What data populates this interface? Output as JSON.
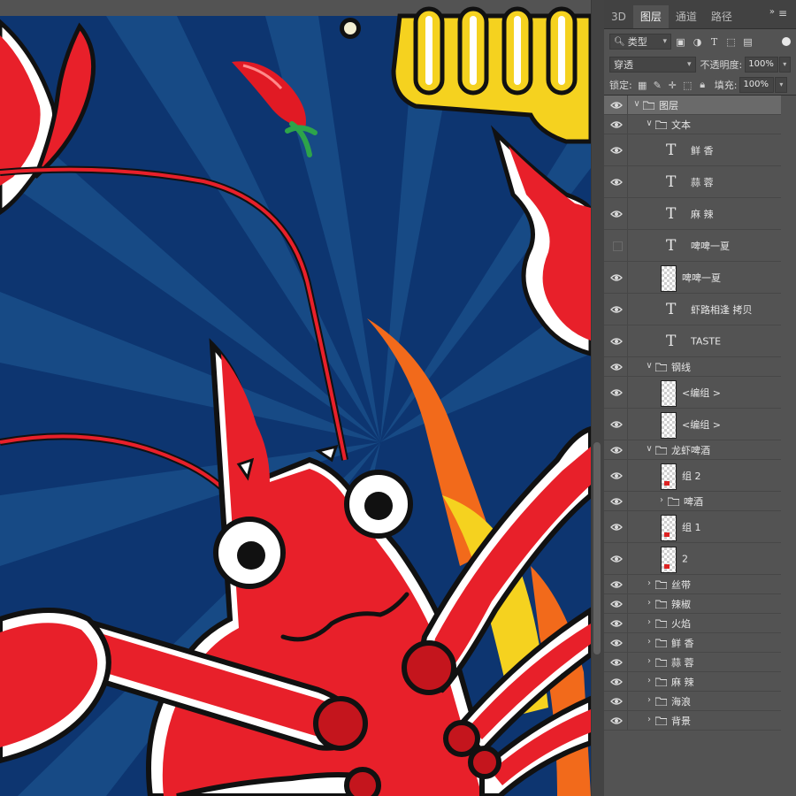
{
  "panel": {
    "tabs": [
      "3D",
      "图层",
      "通道",
      "路径"
    ],
    "active_tab": "图层",
    "filter": {
      "kind_label": "类型"
    },
    "blend_mode": "穿透",
    "opacity_label": "不透明度:",
    "opacity_value": "100%",
    "lock_label": "锁定:",
    "fill_label": "填充:",
    "fill_value": "100%"
  },
  "layers": [
    {
      "name": "图层",
      "type": "group",
      "indent": 0,
      "visible": true,
      "expanded": true,
      "selected": true
    },
    {
      "name": "文本",
      "type": "group",
      "indent": 1,
      "visible": true,
      "expanded": true
    },
    {
      "name": "鲜 香",
      "type": "text",
      "indent": 2,
      "visible": true
    },
    {
      "name": "蒜 蓉",
      "type": "text",
      "indent": 2,
      "visible": true
    },
    {
      "name": "麻 辣",
      "type": "text",
      "indent": 2,
      "visible": true
    },
    {
      "name": "啤啤一夏",
      "type": "text",
      "indent": 2,
      "visible": false
    },
    {
      "name": "啤啤一夏",
      "type": "pixel",
      "indent": 2,
      "visible": true
    },
    {
      "name": "虾路相逢 拷贝",
      "type": "text",
      "indent": 2,
      "visible": true
    },
    {
      "name": "TASTE",
      "type": "text",
      "indent": 2,
      "visible": true
    },
    {
      "name": "钢线",
      "type": "group",
      "indent": 1,
      "visible": true,
      "expanded": true
    },
    {
      "name": "<编组 >",
      "type": "pixel",
      "indent": 2,
      "visible": true
    },
    {
      "name": "<编组 >",
      "type": "pixel",
      "indent": 2,
      "visible": true
    },
    {
      "name": "龙虾啤酒",
      "type": "group",
      "indent": 1,
      "visible": true,
      "expanded": true
    },
    {
      "name": "组 2",
      "type": "pixel",
      "indent": 2,
      "visible": true,
      "red": true
    },
    {
      "name": "啤酒",
      "type": "group",
      "indent": 2,
      "visible": true,
      "expanded": false
    },
    {
      "name": "组 1",
      "type": "pixel",
      "indent": 2,
      "visible": true,
      "red": true
    },
    {
      "name": "2",
      "type": "pixel",
      "indent": 2,
      "visible": true,
      "red": true
    },
    {
      "name": "丝带",
      "type": "group",
      "indent": 1,
      "visible": true,
      "expanded": false
    },
    {
      "name": "辣椒",
      "type": "group",
      "indent": 1,
      "visible": true,
      "expanded": false
    },
    {
      "name": "火焰",
      "type": "group",
      "indent": 1,
      "visible": true,
      "expanded": false
    },
    {
      "name": "鲜 香",
      "type": "group",
      "indent": 1,
      "visible": true,
      "expanded": false
    },
    {
      "name": "蒜 蓉",
      "type": "group",
      "indent": 1,
      "visible": true,
      "expanded": false
    },
    {
      "name": "麻 辣",
      "type": "group",
      "indent": 1,
      "visible": true,
      "expanded": false
    },
    {
      "name": "海浪",
      "type": "group",
      "indent": 1,
      "visible": true,
      "expanded": false
    },
    {
      "name": "背景",
      "type": "group",
      "indent": 1,
      "visible": true,
      "expanded": false
    }
  ],
  "colors": {
    "background_blue": "#0d3570",
    "ray_blue": "#16477f",
    "lobster_red": "#e8202a",
    "yellow": "#f5d21f",
    "flame_orange": "#f26a1b",
    "outline": "#111111"
  }
}
